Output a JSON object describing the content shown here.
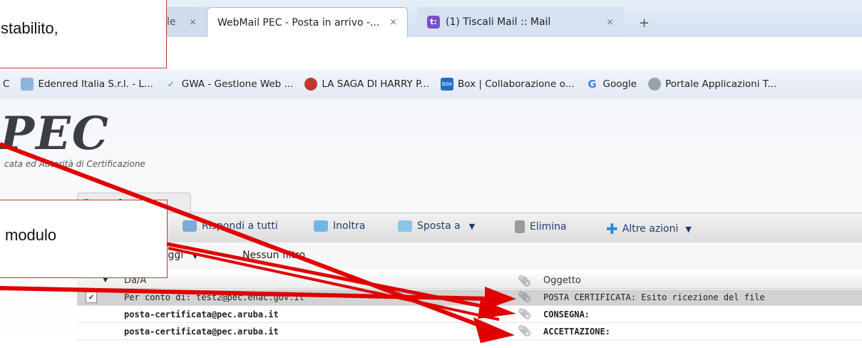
{
  "tabs": [
    {
      "label": "le",
      "close": "×"
    },
    {
      "label": "WebMail PEC - Posta in arrivo -...",
      "close": "×"
    },
    {
      "label": "(1) Tiscali Mail :: Mail",
      "close": "×",
      "favicon": "t:"
    }
  ],
  "new_tab": "+",
  "bookmarks": [
    {
      "label": "C",
      "icon": "bookmark-icon"
    },
    {
      "label": "Edenred Italia S.r.l. - L...",
      "icon": "edenred-icon"
    },
    {
      "label": "GWA - Gestione Web ...",
      "icon": "gwa-icon"
    },
    {
      "label": "LA SAGA DI HARRY P...",
      "icon": "harry-potter-icon"
    },
    {
      "label": "Box | Collaborazione o...",
      "icon": "box-icon",
      "badge": "box"
    },
    {
      "label": "Google",
      "icon": "google-icon",
      "badge": "G"
    },
    {
      "label": "Portale Applicazioni T...",
      "icon": "portale-icon"
    }
  ],
  "logo": {
    "text": "PEC",
    "subtitle": "cata ed Autorità di Certificazione"
  },
  "folder_tab": "Posta in arrivo",
  "toolbar": {
    "reply_all": "Rispondi a tutti",
    "forward": "Inoltra",
    "move": "Sposta a",
    "delete": "Elimina",
    "more": "Altre azioni",
    "dropdown": "▼"
  },
  "filterbar": {
    "messages": "messaggi",
    "filter": "Nessun filtro",
    "dropdown": "▼"
  },
  "list": {
    "header_from": "Da/A",
    "header_subject": "Oggetto",
    "rows": [
      {
        "checked": "✔",
        "from": "Per conto di: test2@pec.enac.gov.it",
        "subject": "POSTA CERTIFICATA: Esito ricezione del file"
      },
      {
        "from": "posta-certificata@pec.aruba.it",
        "subject": "CONSEGNA:"
      },
      {
        "from": "posta-certificata@pec.aruba.it",
        "subject": "ACCETTAZIONE:"
      }
    ]
  },
  "callouts": {
    "first": "stabilito,",
    "second": "modulo"
  },
  "colors": {
    "arrow": "#e00000",
    "callout_border": "#c0392b",
    "selected_row": "#d2d2d2"
  }
}
